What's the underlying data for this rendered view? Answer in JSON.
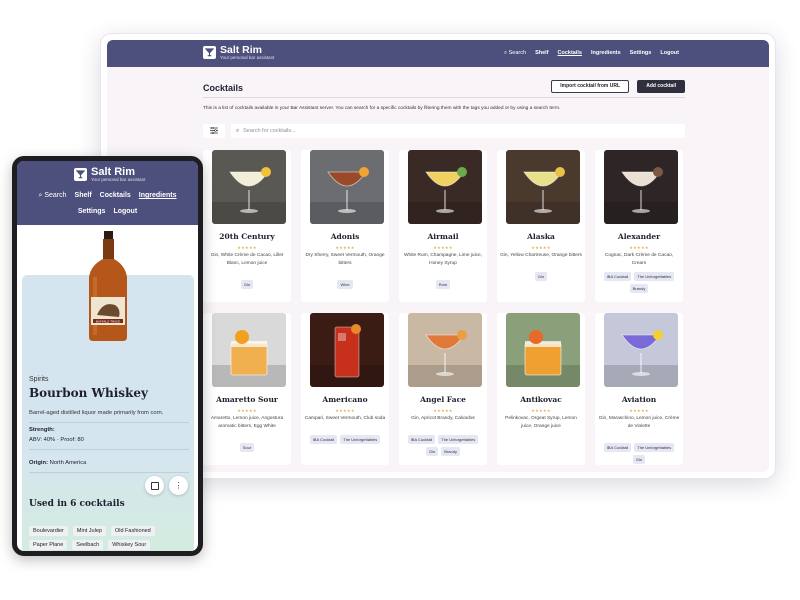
{
  "brand": {
    "name": "Salt Rim",
    "tagline": "Your personal bar assistant"
  },
  "desktop": {
    "nav": {
      "search": "Search",
      "items": [
        "Shelf",
        "Cocktails",
        "Ingredients",
        "Settings",
        "Logout"
      ],
      "active": "Cocktails"
    },
    "page_title": "Cocktails",
    "import_button": "Import cocktail from URL",
    "add_button": "Add cocktail",
    "description": "This is a list of cocktails available in your Bar Assistant server. You can search for a specific cocktails by filtering them with the tags you added or by using a search term.",
    "search_placeholder": "Search for cocktails...",
    "stars": "★★★★★",
    "cocktails": [
      {
        "name": "20th Century",
        "ingredients": "Gin, White Crème de Cacao, Lillet Blanc, Lemon juice",
        "tags": [
          "Gin"
        ],
        "glass": "coupe",
        "drink": "#f2efd8",
        "bg": "#5a5852",
        "garnish": "#f2c23a"
      },
      {
        "name": "Adonis",
        "ingredients": "Dry Sherry, Sweet Vermouth, Orange bitters",
        "tags": [
          "Wine"
        ],
        "glass": "coupe",
        "drink": "#9a4a2a",
        "bg": "#6b6d70",
        "garnish": "#f0a534"
      },
      {
        "name": "Airmail",
        "ingredients": "White Rum, Champagne, Lime juice, Honey Syrup",
        "tags": [
          "Rum"
        ],
        "glass": "coupe",
        "drink": "#f0d060",
        "bg": "#3a2a26",
        "garnish": "#6fa84a"
      },
      {
        "name": "Alaska",
        "ingredients": "Gin, Yellow Chartreuse, Orange bitters",
        "tags": [
          "Gin"
        ],
        "glass": "coupe",
        "drink": "#e8e08a",
        "bg": "#4a3a2e",
        "garnish": "#e8c04a"
      },
      {
        "name": "Alexander",
        "ingredients": "Cognac, Dark Crème de Cacao, Cream",
        "tags": [
          "IBA Cocktail",
          "The Unforgettables",
          "Brandy"
        ],
        "glass": "coupe",
        "drink": "#ece0d4",
        "bg": "#2e2626",
        "garnish": "#7a5a44"
      },
      {
        "name": "Amaretto Sour",
        "ingredients": "Amaretto, Lemon juice, Angostura aromatic bitters, Egg White",
        "tags": [
          "Sour"
        ],
        "glass": "rocks",
        "drink": "#f0b050",
        "bg": "#d9d9d9",
        "garnish": "#f2a020"
      },
      {
        "name": "Americano",
        "ingredients": "Campari, Sweet Vermouth, Club soda",
        "tags": [
          "IBA Cocktail",
          "The Unforgettables"
        ],
        "glass": "tall",
        "drink": "#c8301e",
        "bg": "#3a1c14",
        "garnish": "#e88a2a"
      },
      {
        "name": "Angel Face",
        "ingredients": "Gin, Apricot Brandy, Calvados",
        "tags": [
          "IBA Cocktail",
          "The Unforgettables",
          "Gin",
          "Brandy"
        ],
        "glass": "coupe",
        "drink": "#e07a3a",
        "bg": "#c9b8a4",
        "garnish": "#e8a040"
      },
      {
        "name": "Antikovac",
        "ingredients": "Pelinkovac, Orgeat Syrup, Lemon juice, Orange juice",
        "tags": [],
        "glass": "rocks",
        "drink": "#f0a030",
        "bg": "#8aa07a",
        "garnish": "#e86a2a"
      },
      {
        "name": "Aviation",
        "ingredients": "Gin, Maraschino, Lemon juice, Crème de Violette",
        "tags": [
          "IBA Cocktail",
          "The Unforgettables",
          "Gin"
        ],
        "glass": "coupe",
        "drink": "#7a6ad8",
        "bg": "#c4c8d8",
        "garnish": "#f2d030"
      }
    ]
  },
  "mobile": {
    "nav": {
      "search": "Search",
      "row1": [
        "Shelf",
        "Cocktails",
        "Ingredients"
      ],
      "row2": [
        "Settings",
        "Logout"
      ],
      "active": "Ingredients"
    },
    "category": "Spirits",
    "name": "Bourbon Whiskey",
    "description": "Barrel-aged distilled liquor made primarily from corn.",
    "strength_label": "Strength:",
    "strength_value": "ABV: 40% · Proof: 80",
    "origin_label": "Origin:",
    "origin_value": "North America",
    "used_in_title": "Used in 6 cocktails",
    "cocktails": [
      "Boulevardier",
      "Mint Julep",
      "Old Fashioned",
      "Paper Plane",
      "Seelbach",
      "Whiskey Sour"
    ],
    "bottle_label": "BUFFALO TRACE"
  },
  "icons": {
    "search": "search-icon",
    "filter": "filter-icon",
    "logo": "cocktail-glass-icon",
    "checkbox": "checkbox-icon",
    "more": "more-vertical-icon"
  },
  "colors": {
    "nav": "#4d4f7c",
    "page": "#f8f4f7",
    "star": "#e8b04a",
    "tag": "#e6e7f4",
    "panel": "#d5e5ef"
  }
}
